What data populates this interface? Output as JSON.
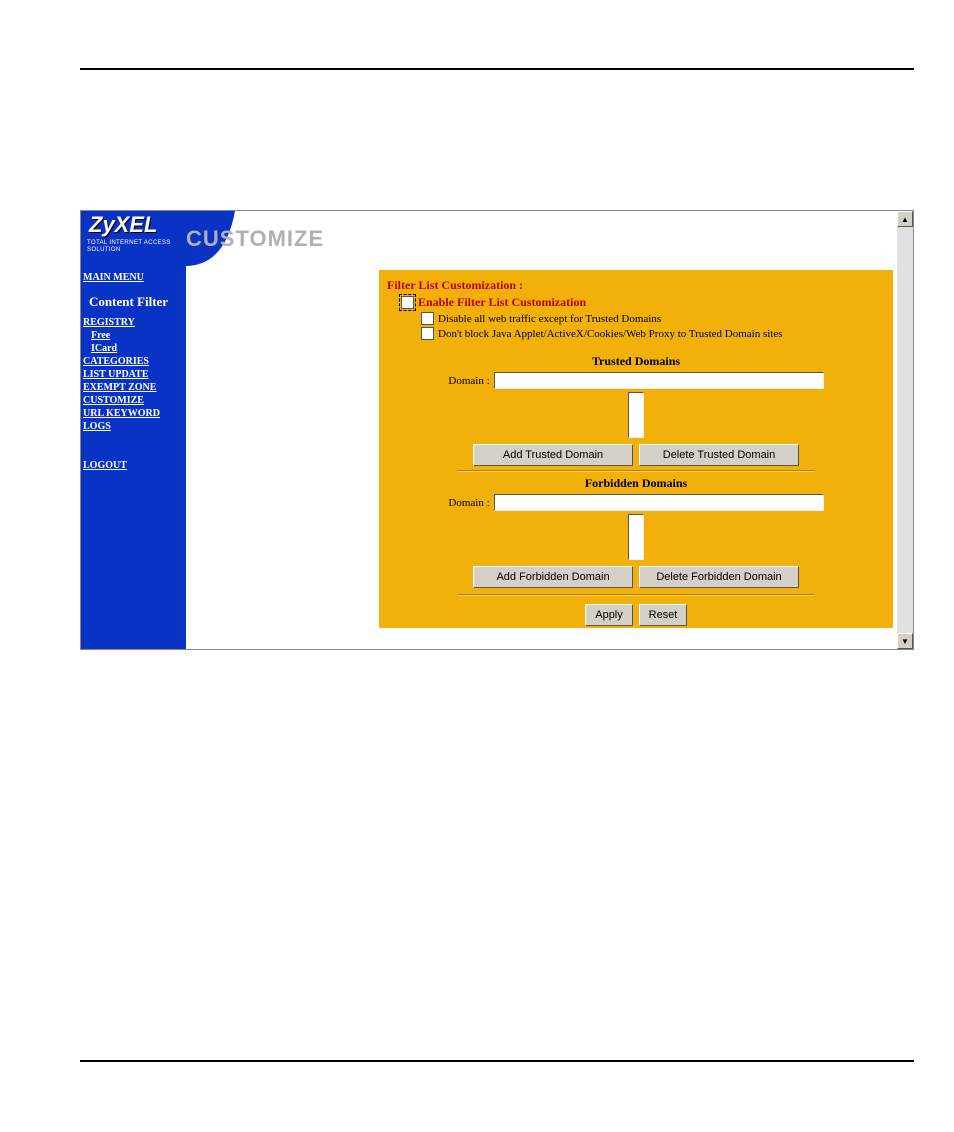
{
  "brand": {
    "name": "ZyXEL",
    "tagline": "TOTAL INTERNET ACCESS SOLUTION"
  },
  "sidebar": {
    "main_menu": "MAIN MENU",
    "section_title": "Content Filter",
    "items": {
      "registry": "REGISTRY",
      "free": "Free",
      "icard": "ICard",
      "categories": "CATEGORIES",
      "list_update": "LIST UPDATE",
      "exempt_zone": "EXEMPT ZONE",
      "customize": "CUSTOMIZE",
      "url_keyword": "URL KEYWORD",
      "logs": "LOGS",
      "logout": "LOGOUT"
    }
  },
  "page": {
    "title": "CUSTOMIZE"
  },
  "content": {
    "heading": "Filter List Customization :",
    "enable_label": "Enable Filter List Customization",
    "opt_disable_all": "Disable all web traffic except for Trusted Domains",
    "opt_dont_block": "Don't block Java Applet/ActiveX/Cookies/Web Proxy to Trusted Domain sites",
    "trusted": {
      "title": "Trusted Domains",
      "domain_label": "Domain :",
      "domain_value": "",
      "add_btn": "Add Trusted Domain",
      "del_btn": "Delete Trusted Domain"
    },
    "forbidden": {
      "title": "Forbidden Domains",
      "domain_label": "Domain :",
      "domain_value": "",
      "add_btn": "Add Forbidden Domain",
      "del_btn": "Delete Forbidden Domain"
    },
    "apply_btn": "Apply",
    "reset_btn": "Reset"
  }
}
